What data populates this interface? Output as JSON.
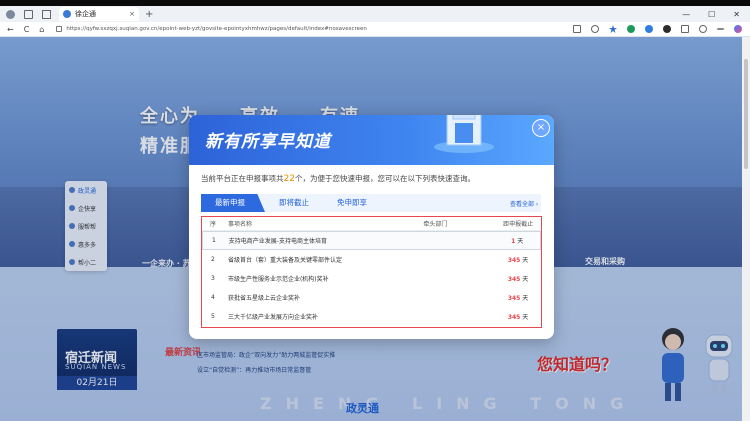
{
  "browser": {
    "tab_title": "徐企通",
    "tab_close": "×",
    "new_tab": "+",
    "url": "https://qyfw.sxzqxj.suqian.gov.cn/epoint-web-yzt/govsite-epointyxhmhwz/pages/default/index#nosavescreen",
    "nav": {
      "back": "←",
      "forward": "→",
      "reload": "C",
      "home": "⌂"
    },
    "window_controls": {
      "minimize": "—",
      "maximize": "☐",
      "close": "✕"
    }
  },
  "hero": {
    "title": "全心为……高效……有速",
    "subtitle": "精准服"
  },
  "side_menu": [
    {
      "label": "政灵通",
      "active": true
    },
    {
      "label": "企快享",
      "active": false
    },
    {
      "label": "服帮帮",
      "active": false
    },
    {
      "label": "惠多多",
      "active": false
    },
    {
      "label": "帮小二",
      "active": false
    }
  ],
  "left_panel": "一企来办 · 苏",
  "right_panel": "交易和采购",
  "news": {
    "brand": "宿迁新闻",
    "brand_en": "SUQIAN NEWS",
    "date": "02月21日",
    "label": "最新资讯",
    "items": [
      "区市场监管局：政企“双向发力”助力两城监管促实推",
      "设立“自觉检测”：再力推动市场日常监督管"
    ]
  },
  "bottom": {
    "banner": "ZHENG LING TONG",
    "logo": "政灵通"
  },
  "promo": {
    "text": "您知道吗？"
  },
  "modal": {
    "title": "新有所享早知道",
    "close": "×",
    "intro_prefix": "当前平台正在申报事项共",
    "count": "22",
    "intro_suffix": "个，为便于您快速申报，您可以在以下列表快速查询。",
    "view_all": "查看全部 ›",
    "tabs": [
      {
        "label": "最新申报",
        "active": true
      },
      {
        "label": "即将截止",
        "active": false
      },
      {
        "label": "免申即享",
        "active": false
      }
    ],
    "columns": {
      "no": "序",
      "name": "事项名称",
      "dept": "牵头部门",
      "days": "距申报截止"
    },
    "rows": [
      {
        "no": "1",
        "name": "支持电商产业发展-支持电商主体培育",
        "dept": "",
        "days": "1",
        "unit": "天"
      },
      {
        "no": "2",
        "name": "省级首台（套）重大装备及关键零部件认定",
        "dept": "",
        "days": "345",
        "unit": "天"
      },
      {
        "no": "3",
        "name": "市级生产性服务业示范企业(机构)奖补",
        "dept": "",
        "days": "345",
        "unit": "天"
      },
      {
        "no": "4",
        "name": "获批省五星级上云企业奖补",
        "dept": "",
        "days": "345",
        "unit": "天"
      },
      {
        "no": "5",
        "name": "三大千亿级产业发展方向企业奖补",
        "dept": "",
        "days": "345",
        "unit": "天"
      }
    ]
  },
  "colors": {
    "primary": "#2d6ae0",
    "accent_red": "#e5484d",
    "count_orange": "#f08c00"
  }
}
